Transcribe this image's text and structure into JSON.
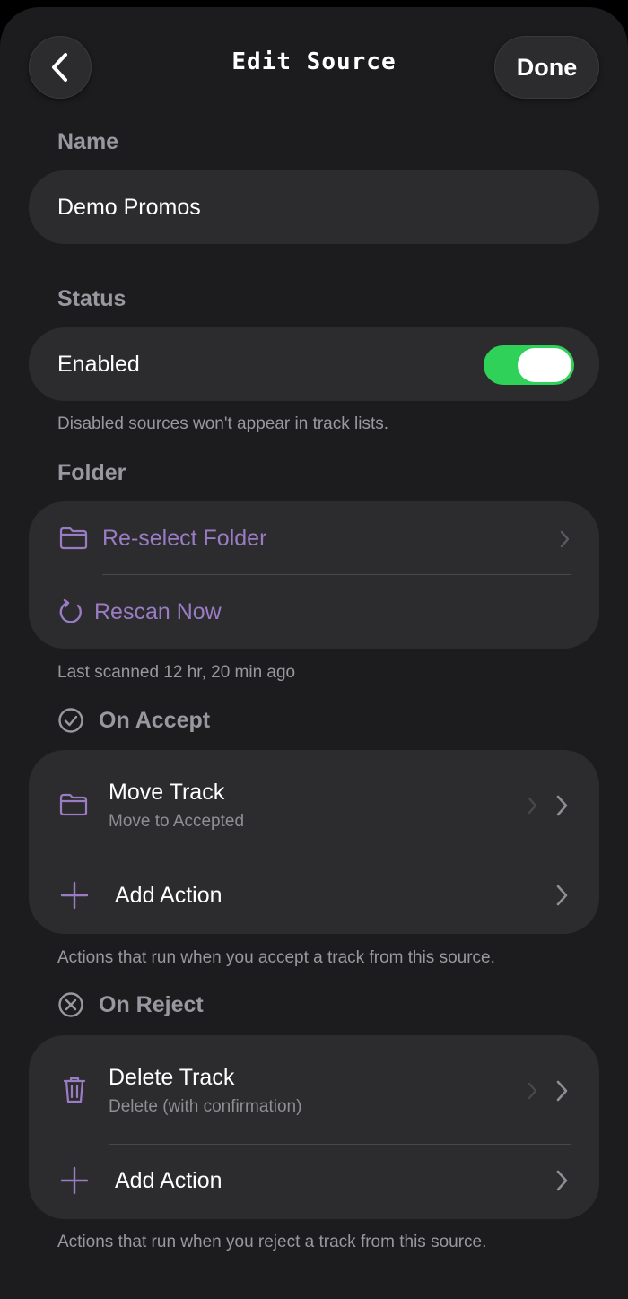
{
  "nav": {
    "title": "Edit Source",
    "back_icon": "chevron-left-icon",
    "done_label": "Done"
  },
  "name_section": {
    "header": "Name",
    "value": "Demo Promos"
  },
  "status_section": {
    "header": "Status",
    "label": "Enabled",
    "enabled": true,
    "footer": "Disabled sources won't appear in track lists."
  },
  "folder_section": {
    "header": "Folder",
    "reselect_label": "Re-select Folder",
    "reselect_icon": "folder-icon",
    "rescan_label": "Rescan Now",
    "rescan_icon": "refresh-icon",
    "footer": "Last scanned 12 hr, 20 min ago"
  },
  "accept_section": {
    "header": "On Accept",
    "header_icon": "checkmark-circle-icon",
    "action_title": "Move Track",
    "action_subtitle": "Move to Accepted",
    "action_icon": "folder-icon",
    "add_label": "Add Action",
    "footer": "Actions that run when you accept a track from this source."
  },
  "reject_section": {
    "header": "On Reject",
    "header_icon": "x-circle-icon",
    "action_title": "Delete Track",
    "action_subtitle": "Delete (with confirmation)",
    "action_icon": "trash-icon",
    "add_label": "Add Action",
    "footer": "Actions that run when you reject a track from this source."
  },
  "colors": {
    "accent": "#9a7cc4",
    "toggle_on": "#30d158",
    "card": "#2c2c2e",
    "background": "#1c1c1e"
  }
}
